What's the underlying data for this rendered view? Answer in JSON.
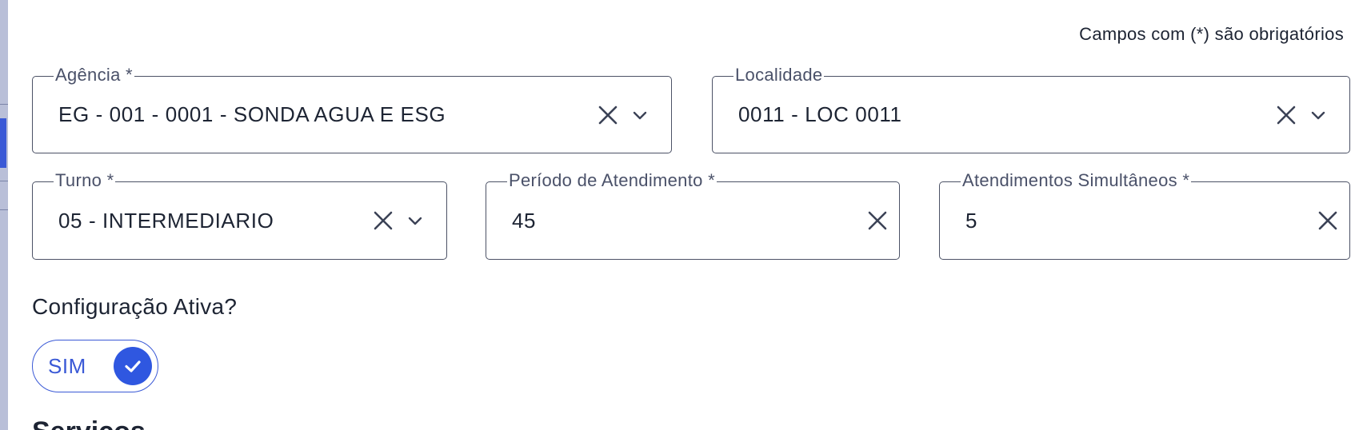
{
  "form": {
    "required_note": "Campos com (*) são obrigatórios",
    "agencia": {
      "label": "Agência *",
      "value": "EG - 001 - 0001 - SONDA AGUA E ESG"
    },
    "localidade": {
      "label": "Localidade",
      "value": "0011 - LOC 0011"
    },
    "turno": {
      "label": "Turno *",
      "value": "05 - INTERMEDIARIO"
    },
    "periodo": {
      "label": "Período de Atendimento *",
      "value": "45"
    },
    "atendimentos": {
      "label": "Atendimentos Simultâneos *",
      "value": "5"
    },
    "config_ativa": {
      "label": "Configuração Ativa?",
      "toggle_text": "SIM",
      "checked": true
    },
    "next_section_partial": "Serviços"
  },
  "icons": {
    "clear": "close-icon",
    "dropdown": "chevron-down-icon",
    "check": "check-icon"
  },
  "colors": {
    "accent": "#2f57e0",
    "border": "#4c5266",
    "label": "#4a5169",
    "text": "#1d2433"
  }
}
